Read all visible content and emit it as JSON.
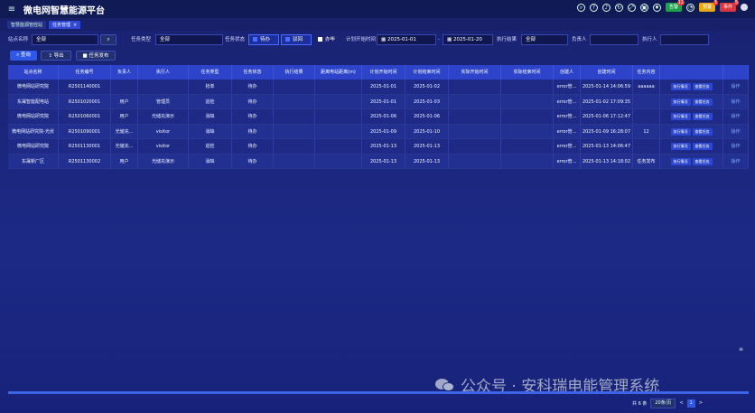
{
  "header": {
    "title": "微电网智慧能源平台",
    "menu_icon": "hamburger-icon"
  },
  "header_badges": [
    {
      "label": "告警",
      "count": "12"
    },
    {
      "label": "预警",
      "count": "3"
    },
    {
      "label": "事件",
      "count": "5"
    }
  ],
  "tabs": [
    {
      "label": "智慧能源管控站"
    },
    {
      "label": "任务管理",
      "close": "×"
    }
  ],
  "filters": {
    "station_label": "站点名称",
    "station_value": "全部",
    "type_label": "任务类型",
    "type_value": "全部",
    "status_label": "任务状态",
    "status_opt1": "待办",
    "status_opt2": "驳回",
    "status_opt3": "办毕",
    "plan_time_label": "计划开始时间",
    "date_from": "2025-01-01",
    "date_sep": "-",
    "date_to": "2025-01-20",
    "result_label": "执行结果",
    "result_value": "全部",
    "owner_label": "负责人",
    "executor_label": "执行人"
  },
  "toolbar": {
    "query": "查询",
    "export": "导出",
    "publish": "任务发布"
  },
  "table": {
    "headers": [
      "站点名称",
      "任务编号",
      "负责人",
      "执行人",
      "任务类型",
      "任务状态",
      "执行结果",
      "距离电站距离(m)",
      "计划开始时间",
      "计划结束时间",
      "实际开始时间",
      "实际结束时间",
      "创建人",
      "创建时间",
      "任务内容",
      "",
      ""
    ],
    "action1": "执行情况",
    "action2": "查看任务",
    "op": "操作",
    "rows": [
      [
        "微电网站研究院",
        "R2501140001",
        "",
        "",
        "抢单",
        "待办",
        "",
        "",
        "2025-01-01",
        "2025-01-02",
        "",
        "",
        "error管...",
        "2025-01-14 14:06:59",
        "aaaaaa"
      ],
      [
        "东晟智能配电站",
        "R2501020001",
        "用户",
        "管理员",
        "巡检",
        "待办",
        "",
        "",
        "2025-01-01",
        "2025-01-03",
        "",
        "",
        "error管...",
        "2025-01-02 17:09:35",
        ""
      ],
      [
        "微电网站研究院",
        "R2501060001",
        "用户",
        "光储充演示",
        "消缺",
        "待办",
        "",
        "",
        "2025-01-06",
        "2025-01-06",
        "",
        "",
        "error管...",
        "2025-01-06 17:12:47",
        ""
      ],
      [
        "微电网站研究院-光伏",
        "R2501090001",
        "光储充...",
        "visitor",
        "消缺",
        "待办",
        "",
        "",
        "2025-01-09",
        "2025-01-10",
        "",
        "",
        "error管...",
        "2025-01-09 16:28:07",
        "12"
      ],
      [
        "微电网站研究院",
        "R2501130001",
        "光储充...",
        "visitor",
        "巡检",
        "待办",
        "",
        "",
        "2025-01-13",
        "2025-01-13",
        "",
        "",
        "error管...",
        "2025-01-13 14:06:47",
        ""
      ],
      [
        "东晟新厂区",
        "R2501130002",
        "用户",
        "光储充演示",
        "消缺",
        "待办",
        "",
        "",
        "2025-01-13",
        "2025-01-13",
        "",
        "",
        "error管...",
        "2025-01-13 14:18:02",
        "任务发布"
      ]
    ]
  },
  "pagination": {
    "total": "共 6 条",
    "page_size": "20条/页",
    "prev": "<",
    "current": "1",
    "next": ">"
  },
  "watermark": "公众号 · 安科瑞电能管理系统",
  "colors": {
    "background": "#1c2a86",
    "header_row": "#2d43c9",
    "accent": "#2f58e8"
  }
}
